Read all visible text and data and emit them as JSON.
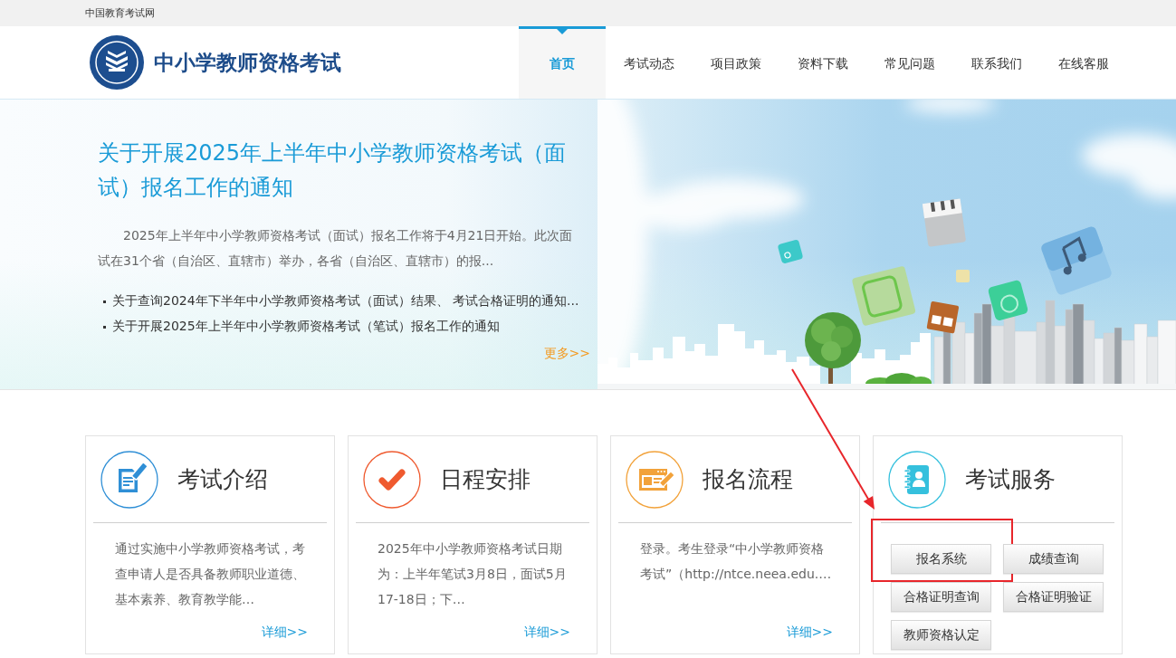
{
  "top_bar": {
    "site_name": "中国教育考试网"
  },
  "header": {
    "title": "中小学教师资格考试",
    "nav": [
      {
        "label": "首页",
        "selected": true
      },
      {
        "label": "考试动态",
        "selected": false
      },
      {
        "label": "项目政策",
        "selected": false
      },
      {
        "label": "资料下载",
        "selected": false
      },
      {
        "label": "常见问题",
        "selected": false
      },
      {
        "label": "联系我们",
        "selected": false
      },
      {
        "label": "在线客服",
        "selected": false
      }
    ]
  },
  "banner": {
    "headline": "关于开展2025年上半年中小学教师资格考试（面试）报名工作的通知",
    "summary": "2025年上半年中小学教师资格考试（面试）报名工作将于4月21日开始。此次面试在31个省（自治区、直辖市）举办，各省（自治区、直辖市）的报...",
    "news": [
      "关于查询2024年下半年中小学教师资格考试（面试）结果、 考试合格证明的通知...",
      "关于开展2025年上半年中小学教师资格考试（笔试）报名工作的通知"
    ],
    "more_link": "更多>>"
  },
  "cards": [
    {
      "kind": "article",
      "title": "考试介绍",
      "color": "#2f8fd6",
      "body": "通过实施中小学教师资格考试，考查申请人是否具备教师职业道德、基本素养、教育教学能…",
      "link": "详细>>"
    },
    {
      "kind": "article",
      "title": "日程安排",
      "color": "#ef5a2f",
      "body": "2025年中小学教师资格考试日期为：上半年笔试3月8日，面试5月17-18日；下…",
      "link": "详细>>"
    },
    {
      "kind": "article",
      "title": "报名流程",
      "color": "#f2a23a",
      "body": "登录。考生登录“中小学教师资格考试”（http://ntce.neea.edu.…",
      "link": "详细>>"
    },
    {
      "kind": "services",
      "title": "考试服务",
      "color": "#35c0dd",
      "buttons": [
        {
          "label": "报名系统",
          "highlighted": true
        },
        {
          "label": "成绩查询",
          "highlighted": false
        },
        {
          "label": "合格证明查询",
          "highlighted": false
        },
        {
          "label": "合格证明验证",
          "highlighted": false
        },
        {
          "label": "教师资格认定",
          "highlighted": false
        }
      ]
    }
  ]
}
